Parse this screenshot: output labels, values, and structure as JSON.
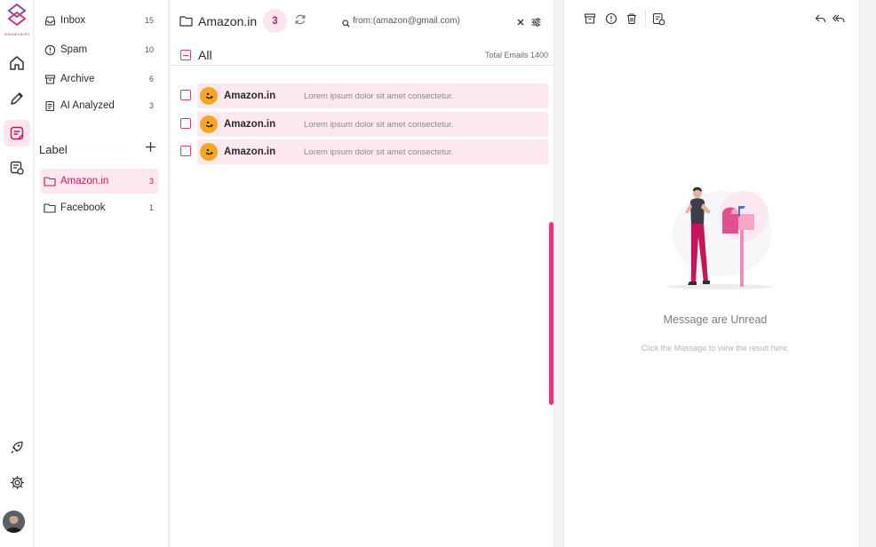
{
  "brand": {
    "logo_text": "SHIVDEVSOFT",
    "accent": "#c2185b"
  },
  "rail": {
    "items": [
      {
        "icon": "home-icon"
      },
      {
        "icon": "pencil-icon"
      },
      {
        "icon": "mail-note-icon"
      },
      {
        "icon": "mail-settings-icon"
      }
    ],
    "bottom": [
      {
        "icon": "rocket-icon"
      },
      {
        "icon": "gear-icon"
      }
    ]
  },
  "folders": {
    "items": [
      {
        "label": "Inbox",
        "count": "15",
        "icon": "inbox-icon"
      },
      {
        "label": "Spam",
        "count": "10",
        "icon": "alert-circle-icon"
      },
      {
        "label": "Archive",
        "count": "6",
        "icon": "archive-icon"
      },
      {
        "label": "AI Analyzed",
        "count": "3",
        "icon": "ai-doc-icon"
      }
    ],
    "label_heading": "Label",
    "labels": [
      {
        "label": "Amazon.in",
        "count": "3",
        "icon": "folder-icon",
        "active": true
      },
      {
        "label": "Facebook",
        "count": "1",
        "icon": "folder-icon",
        "active": false
      }
    ]
  },
  "list": {
    "folder_title": "Amazon.in",
    "count": "3",
    "search": {
      "value": "from:(amazon@gmail.com)",
      "placeholder": "Search"
    },
    "all_label": "All",
    "total": "Total Emails 1400",
    "emails": [
      {
        "sender": "Amazon.in",
        "snippet": "Lorem ipsum dolor sit amet consectetur."
      },
      {
        "sender": "Amazon.in",
        "snippet": "Lorem ipsum dolor sit amet consectetur."
      },
      {
        "sender": "Amazon.in",
        "snippet": "Lorem ipsum dolor sit amet consectetur."
      }
    ]
  },
  "pane": {
    "toolbar": [
      "archive-icon",
      "alert-circle-icon",
      "trash-icon",
      "mail-settings-icon",
      "reply-icon",
      "reply-all-icon"
    ],
    "empty_title": "Message are Unread",
    "empty_sub": "Click the Massage to view the result here."
  }
}
